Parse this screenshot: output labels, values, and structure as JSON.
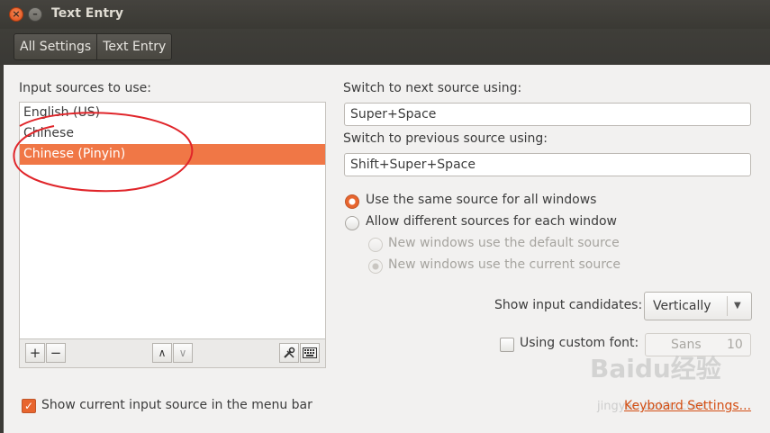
{
  "window": {
    "title": "Text Entry"
  },
  "breadcrumb": [
    "All Settings",
    "Text Entry"
  ],
  "sources": {
    "heading": "Input sources to use:",
    "items": [
      "English (US)",
      "Chinese",
      "Chinese (Pinyin)"
    ],
    "selected_index": 2
  },
  "list_toolbar": {
    "add": "+",
    "remove": "−",
    "up": "∧",
    "down": "∨"
  },
  "switch_next": {
    "label": "Switch to next source using:",
    "value": "Super+Space"
  },
  "switch_prev": {
    "label": "Switch to previous source using:",
    "value": "Shift+Super+Space"
  },
  "radio_options": {
    "same": "Use the same source for all windows",
    "different": "Allow different sources for each window",
    "new_default": "New windows use the default source",
    "new_current": "New windows use the current source",
    "selected": "same"
  },
  "candidates": {
    "label": "Show input candidates:",
    "value": "Vertically"
  },
  "custom_font": {
    "label": "Using custom font:",
    "font_name": "Sans",
    "font_size": "10",
    "checked": false
  },
  "show_menu": {
    "label": "Show current input source in the menu bar",
    "checked": true
  },
  "keyboard_settings_link": "Keyboard Settings...",
  "watermark": {
    "brand": "Baidu经验",
    "url": "jingyan.baidu.com"
  },
  "colors": {
    "accent": "#f07746",
    "annotation": "#e0252a",
    "titlebar": "#3c3b37"
  }
}
